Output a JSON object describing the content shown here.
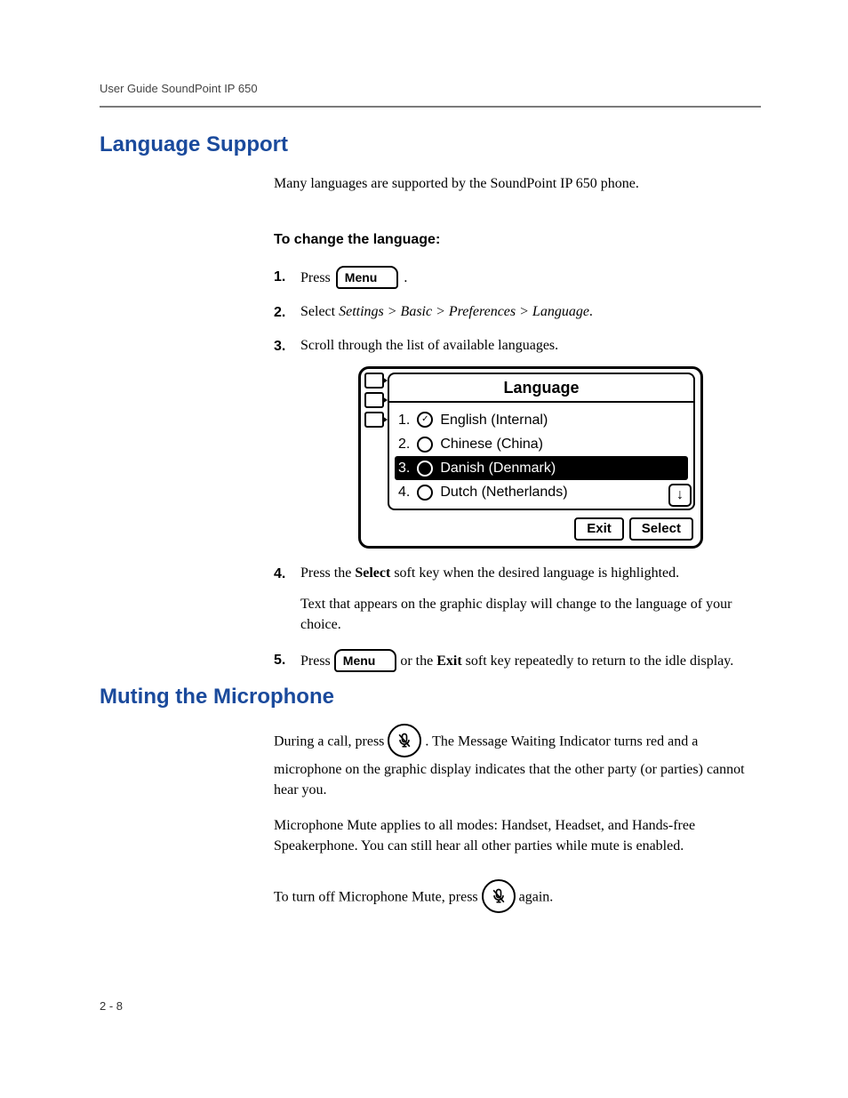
{
  "header": {
    "running": "User Guide SoundPoint IP 650"
  },
  "section1": {
    "title": "Language Support",
    "intro": "Many languages are supported by the SoundPoint IP 650 phone.",
    "subhead": "To change the language:",
    "step1_press": "Press",
    "menu_key": "Menu",
    "step1_period": ".",
    "step2_prefix": "Select ",
    "step2_nav": "Settings > Basic > Preferences > Language",
    "step2_suffix": ".",
    "step3": "Scroll through the list of available languages.",
    "lcd": {
      "title": "Language",
      "items": [
        {
          "idx": "1.",
          "checked": true,
          "label": "English (Internal)",
          "selected": false
        },
        {
          "idx": "2.",
          "checked": false,
          "label": "Chinese (China)",
          "selected": false
        },
        {
          "idx": "3.",
          "checked": false,
          "label": "Danish (Denmark)",
          "selected": true
        },
        {
          "idx": "4.",
          "checked": false,
          "label": "Dutch (Netherlands)",
          "selected": false
        }
      ],
      "soft_exit": "Exit",
      "soft_select": "Select"
    },
    "step4_a": "Press the ",
    "step4_b": "Select",
    "step4_c": " soft key when the desired language is highlighted.",
    "step4_para2": "Text that appears on the graphic display will change to the language of your choice.",
    "step5_a": "Press ",
    "step5_b": " or the ",
    "step5_c": "Exit",
    "step5_d": " soft key repeatedly to return to the idle display."
  },
  "section2": {
    "title": "Muting the Microphone",
    "p1_a": "During a call, press ",
    "p1_b": ". The Message Waiting Indicator turns red and a microphone on the graphic display indicates that the other party (or parties) cannot hear you.",
    "p2": "Microphone Mute applies to all modes: Handset, Headset, and Hands-free Speakerphone. You can still hear all other parties while mute is enabled.",
    "p3_a": "To turn off Microphone Mute, press ",
    "p3_b": " again."
  },
  "footer": {
    "page": "2 - 8"
  }
}
